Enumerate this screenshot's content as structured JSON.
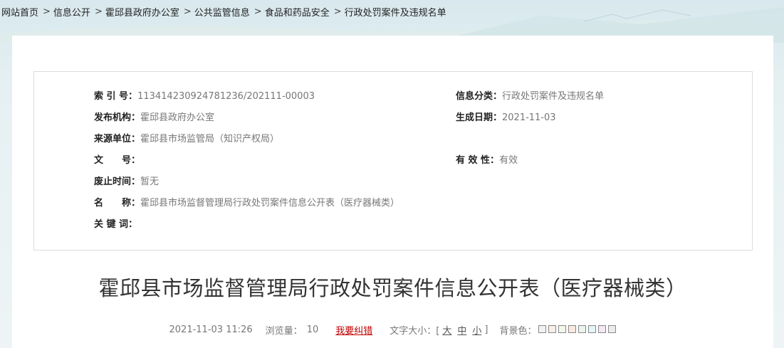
{
  "breadcrumb": [
    {
      "label": "网站首页"
    },
    {
      "label": "信息公开"
    },
    {
      "label": "霍邱县政府办公室"
    },
    {
      "label": "公共监管信息"
    },
    {
      "label": "食品和药品安全"
    },
    {
      "label": "行政处罚案件及违规名单"
    }
  ],
  "breadcrumb_separator": ">",
  "meta": {
    "index_no": {
      "label": "索 引 号：",
      "value": "113414230924781236/202111-00003"
    },
    "category": {
      "label": "信息分类：",
      "value": "行政处罚案件及违规名单"
    },
    "publisher": {
      "label": "发布机构：",
      "value": "霍邱县政府办公室"
    },
    "date": {
      "label": "生成日期：",
      "value": "2021-11-03"
    },
    "source": {
      "label": "来源单位：",
      "value": "霍邱县市场监管局（知识产权局）"
    },
    "doc_no": {
      "label": "文　　号：",
      "value": ""
    },
    "validity": {
      "label": "有 效 性：",
      "value": "有效"
    },
    "expiry": {
      "label": "废止时间：",
      "value": "暂无"
    },
    "name": {
      "label": "名　　称：",
      "value": "霍邱县市场监督管理局行政处罚案件信息公开表（医疗器械类）"
    },
    "keywords": {
      "label": "关 键 词：",
      "value": ""
    }
  },
  "title": "霍邱县市场监督管理局行政处罚案件信息公开表（医疗器械类）",
  "info": {
    "datetime": "2021-11-03 11:26",
    "views_label": "浏览量：",
    "views_value": "10",
    "correct_label": "我要纠错",
    "font_size_label": "文字大小：[",
    "font_large": "大",
    "font_medium": "中",
    "font_small": "小",
    "font_close": "]",
    "bg_label": "背景色：",
    "bg_colors": [
      "#f2f2f2",
      "#f7eee6",
      "#f3f7ea",
      "#fbe9e0",
      "#eaf4ea",
      "#e2f6f6",
      "#f3e8f3",
      "#ececec"
    ]
  }
}
